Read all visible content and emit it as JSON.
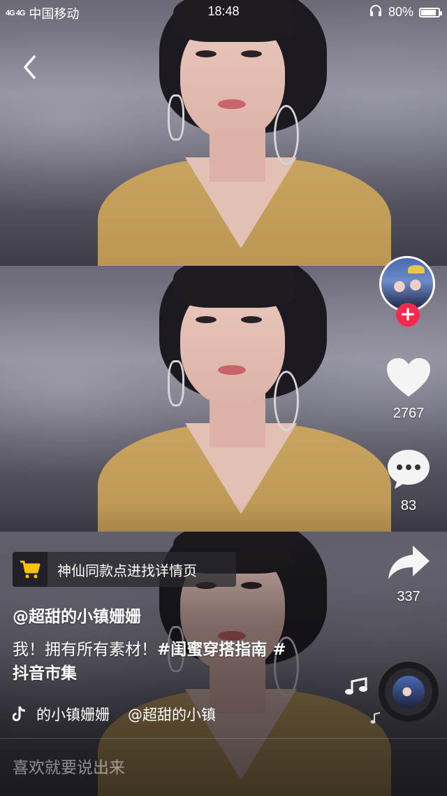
{
  "status_bar": {
    "network": "4G 4G",
    "carrier": "中国移动",
    "time": "18:48",
    "battery": "80%",
    "battery_level": 0.8
  },
  "actions": {
    "likes": "2767",
    "comments": "83",
    "shares": "337"
  },
  "shop": {
    "label": "神仙同款点进找详情页",
    "icon": "cart-icon"
  },
  "author": {
    "username": "@超甜的小镇姗姗"
  },
  "caption": {
    "text": "我！拥有所有素材！",
    "hashtags": [
      "#闺蜜穿搭指南 #",
      "抖音市集"
    ]
  },
  "music": {
    "track": "的小镇姗姗",
    "track_author": "@超甜的小镇"
  },
  "comment": {
    "placeholder": "喜欢就要说出来"
  },
  "colors": {
    "accent": "#f6294f",
    "cart": "#f8c400"
  }
}
